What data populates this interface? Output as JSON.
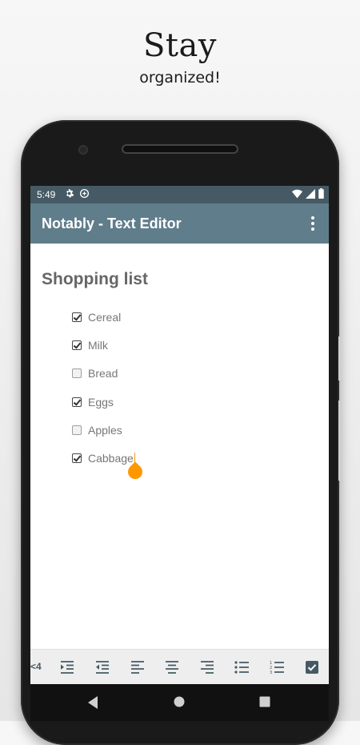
{
  "promo": {
    "title": "Stay",
    "subtitle": "organized!"
  },
  "status_bar": {
    "time": "5:49",
    "left_icons": [
      "settings-icon",
      "sync-icon"
    ],
    "right_icons": [
      "wifi-icon",
      "signal-icon",
      "battery-icon"
    ]
  },
  "app_bar": {
    "title": "Notably - Text Editor",
    "menu_icon": "more-vert-icon"
  },
  "document": {
    "title": "Shopping list",
    "items": [
      {
        "label": "Cereal",
        "checked": true
      },
      {
        "label": "Milk",
        "checked": true
      },
      {
        "label": "Bread",
        "checked": false
      },
      {
        "label": "Eggs",
        "checked": true
      },
      {
        "label": "Apples",
        "checked": false
      },
      {
        "label": "Cabbage",
        "checked": true
      }
    ]
  },
  "toolbar": {
    "partial_label": "<4",
    "buttons": [
      "indent-icon",
      "outdent-icon",
      "align-left-icon",
      "align-center-icon",
      "align-right-icon",
      "bullet-list-icon",
      "numbered-list-icon",
      "checkbox-icon"
    ]
  },
  "nav_bar": {
    "buttons": [
      "back-icon",
      "home-icon",
      "recents-icon"
    ]
  },
  "colors": {
    "status_bar": "#455a64",
    "app_bar": "#607d8b",
    "accent": "#ff9800",
    "toolbar_icon": "#455a64"
  }
}
